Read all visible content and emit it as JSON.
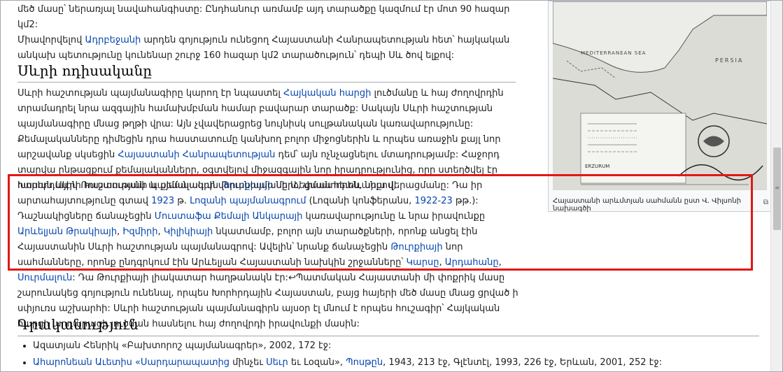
{
  "top_para": {
    "t1": "մեծ մասը՝ ներառյալ նավահանգիստը: Ընդհանուր առմամբ այդ տարածքը կազմում էր մոտ 90 հազար կմ2:",
    "t2": "Միավորվելով ",
    "link1": "Ադրբեջանի",
    "t3": " արդեն գոյություն ունեցող Հայաստանի Հանրապետության հետ՝ հայկական անկախ պետությունը կունենար շուրջ 160 հազար կմ2 տարածություն՝ դեպի Սև ծով ելքով:"
  },
  "section1_title": "Սևրի ոդիսականը",
  "p2": {
    "a": "Սևրի հաշտության պայմանագիրը կարող էր նպաստել ",
    "l1": "Հայկական հարցի",
    "b": " լուծմանը և հայ ժողովրդին տրամադրել նրա ազգային համախմբման համար բավարար տարածք: Սակայն Սևրի հաշտության պայմանագիրը մնաց թղթի վրա: Այն չվավերացրեց նույնիսկ սուլթանական կառավարությունը: Քեմալականները դիմեցին դրա հաստատումը կանխող բոլոր միջոցներին և որպես առաջին քայլ նոր արշավանք սկսեցին ",
    "l2": "Հայաստանի Հանրապետության",
    "c": " դեմ՝ այն ոչնչացնելու մտադրությամբ: Հաջորդ տարվա ընթացքում քեմալականները, օգտվելով միջազգային նոր իրադրությունից, որը ստեղծվել էր Խորհրդային Ռուսաստանի և քեմալական ",
    "l3": "Թուրքիայի",
    "d": " մերձեցման հետևանքով,"
  },
  "p3": {
    "a": "հասան Սևրի հաշտության պայմանագրի վերանայմանը և, փաստորեն, նրա վերացմանը: Դա իր արտահայտությունը գտավ ",
    "l1": "1923",
    "b": " թ. ",
    "l2": "Լոզանի պայմանագրում",
    "c": " (Լոզանի կոնֆերանս, ",
    "l3": "1922-23",
    "d": " թթ.): Դաշնակիցները ճանաչեցին ",
    "l4": "Մուստաֆա Քեմալի Անկարայի",
    "e": " կառավարությունը և նրա իրավունքը ",
    "l5": "Արևելյան Թրակիայի",
    "f": ", ",
    "l6": "Իզմիրի",
    "g": ", ",
    "l7": "Կիլիկիայի",
    "h": " նկատմամբ, բոլոր այն տարածքների, որոնք անցել էին Հայաստանին Սևրի հաշտության պայմանագրով: Ավելին՝ նրանք ճանաչեցին ",
    "l8": "Թուրքիայի",
    "i": " նոր սահմանները, որոնք ընդգրկում էին Արևելյան Հայաստանի նախկին շրջանները՝ ",
    "l9": "Կարսը",
    "j": ", ",
    "l10": "Արդահանը",
    "k": ", ",
    "l11": "Սուրմալուն",
    "m": ": Դա Թուրքիայի լիակատար հաղթանակն էր:↩Պատմական Հայաստանի մի փոքրիկ մասը շարունակեց գոյություն ունենալ, որպես Խորհրդային Հայաստան, բայց հայերի մեծ մասը մնաց ցրված ի սփյուռս աշխարհի: Սևրի հաշտության պայմանագիրն այսօր էլ մնում է որպես հուշագիր՝ Հայկական հարցի արդարացի լուծման հասնելու հայ ժողովրդի իրավունքի մասին:"
  },
  "section2_title": "Գրականություն",
  "refs": [
    {
      "t": "Ազատյան Հենրիկ «Բախտորոշ պայմանագրեր», 2002, 172 էջ:"
    },
    {
      "a": "Ահարոնեան Աւետիս «Սարդարապատից",
      "b": " մինչեւ ",
      "c": "Սեւր",
      "d": " եւ Լօզան», ",
      "e": "Պոսթըն",
      "f": ", 1943, 213 էջ, Գլէնտէլ, 1993, 226 էջ, Երևան, 2001, 252 էջ:"
    }
  ],
  "thumb": {
    "map_label": "MEDITERRANEAN SEA",
    "map_label2": "PERSIA",
    "legend_title": "ERZURUM",
    "caption": "Հայաստանի արևմտյան սահմանն ըստ Վ. Վիլսոնի նախագծի",
    "enlarge_icon": "enlarge-icon"
  },
  "colors": {
    "link": "#0645ad",
    "highlight": "#e01818",
    "text": "#202122"
  }
}
